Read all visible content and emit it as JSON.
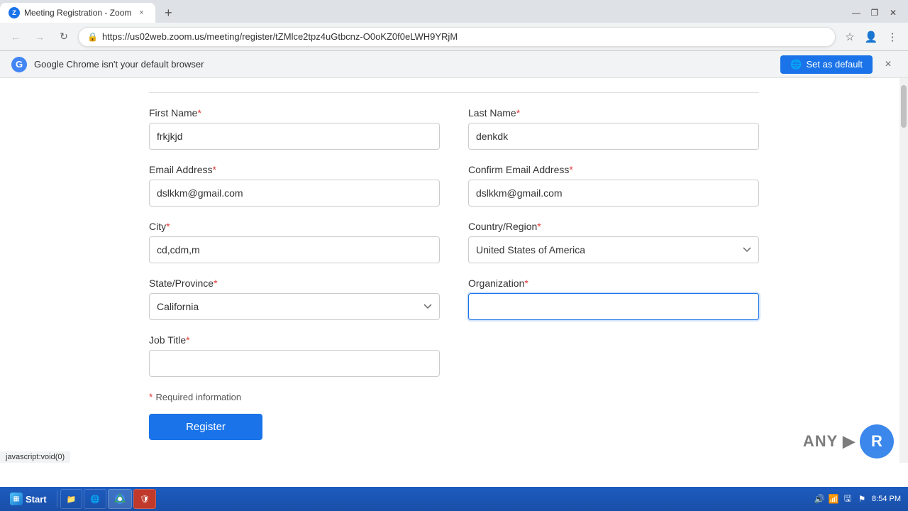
{
  "browser": {
    "tab_title": "Meeting Registration - Zoom",
    "url": "https://us02web.zoom.us/meeting/register/tZMlce2tpz4uGtbcnz-O0oKZ0f0eLWH9YRjM",
    "nav": {
      "back": "←",
      "forward": "→",
      "refresh": "↻"
    }
  },
  "notification": {
    "text": "Google Chrome isn't your default browser",
    "button_label": "Set as default",
    "close": "×"
  },
  "form": {
    "first_name_label": "First Name",
    "first_name_value": "frkjkjd",
    "last_name_label": "Last Name",
    "last_name_value": "denkdk",
    "email_label": "Email Address",
    "email_value": "dslkkm@gmail.com",
    "confirm_email_label": "Confirm Email Address",
    "confirm_email_value": "dslkkm@gmail.com",
    "city_label": "City",
    "city_value": "cd,cdm,m",
    "country_label": "Country/Region",
    "country_value": "United States of America",
    "state_label": "State/Province",
    "state_value": "California",
    "org_label": "Organization",
    "org_value": "",
    "org_placeholder": "",
    "job_title_label": "Job Title",
    "job_title_value": "",
    "required_note": "Required information",
    "register_btn": "Register"
  },
  "status_bar": {
    "text": "javascript:void(0)"
  },
  "taskbar": {
    "start_label": "Start",
    "time": "8:54 PM"
  },
  "watermark": {
    "text": "ANY",
    "logo_letter": "R"
  }
}
